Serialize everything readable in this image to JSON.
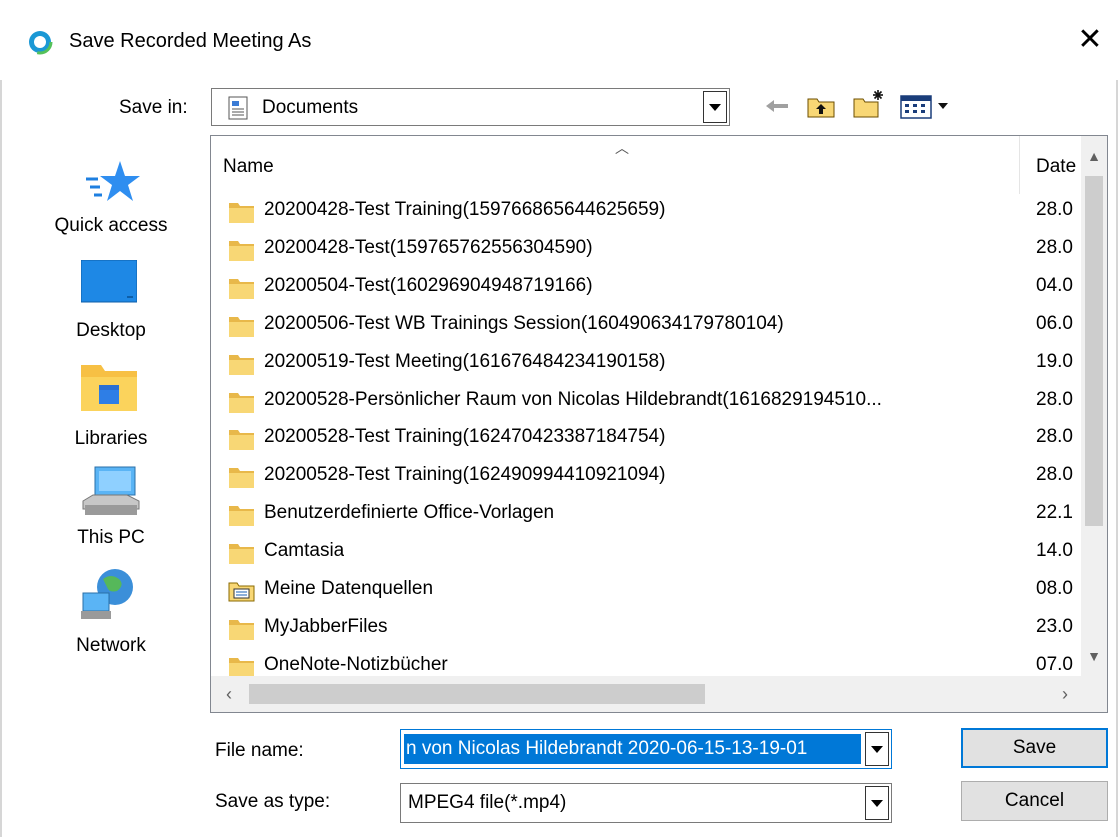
{
  "window": {
    "title": "Save Recorded Meeting As",
    "close": "✕"
  },
  "save_in": {
    "label": "Save in:",
    "value": "Documents"
  },
  "toolbar": {
    "back": "back-arrow",
    "up": "up-folder",
    "new_folder": "new-folder",
    "view_menu": "view-menu"
  },
  "places": [
    {
      "label": "Quick access",
      "icon": "quick-access-star-icon"
    },
    {
      "label": "Desktop",
      "icon": "desktop-icon"
    },
    {
      "label": "Libraries",
      "icon": "libraries-icon"
    },
    {
      "label": "This PC",
      "icon": "this-pc-icon"
    },
    {
      "label": "Network",
      "icon": "network-icon"
    }
  ],
  "list": {
    "columns": {
      "name": "Name",
      "date": "Date"
    },
    "rows": [
      {
        "name": "20200428-Test Training(159766865644625659)",
        "date": "28.0",
        "icon": "folder"
      },
      {
        "name": "20200428-Test(159765762556304590)",
        "date": "28.0",
        "icon": "folder"
      },
      {
        "name": "20200504-Test(160296904948719166)",
        "date": "04.0",
        "icon": "folder"
      },
      {
        "name": "20200506-Test WB Trainings Session(160490634179780104)",
        "date": "06.0",
        "icon": "folder"
      },
      {
        "name": "20200519-Test Meeting(161676484234190158)",
        "date": "19.0",
        "icon": "folder"
      },
      {
        "name": "20200528-Persönlicher Raum von Nicolas Hildebrandt(1616829194510...",
        "date": "28.0",
        "icon": "folder"
      },
      {
        "name": "20200528-Test Training(162470423387184754)",
        "date": "28.0",
        "icon": "folder"
      },
      {
        "name": "20200528-Test Training(162490994410921094)",
        "date": "28.0",
        "icon": "folder"
      },
      {
        "name": "Benutzerdefinierte Office-Vorlagen",
        "date": "22.1",
        "icon": "folder"
      },
      {
        "name": "Camtasia",
        "date": "14.0",
        "icon": "folder"
      },
      {
        "name": "Meine Datenquellen",
        "date": "08.0",
        "icon": "data-sources-folder"
      },
      {
        "name": "MyJabberFiles",
        "date": "23.0",
        "icon": "folder"
      },
      {
        "name": "OneNote-Notizbücher",
        "date": "07.0",
        "icon": "folder"
      }
    ]
  },
  "file_name": {
    "label": "File name:",
    "value": "n von Nicolas Hildebrandt 2020-06-15-13-19-01"
  },
  "save_type": {
    "label": "Save as type:",
    "value": "MPEG4 file(*.mp4)"
  },
  "buttons": {
    "save": "Save",
    "cancel": "Cancel"
  },
  "colors": {
    "selection": "#0078d7",
    "folder": "#f8d775",
    "folder_dark": "#e8b84a"
  }
}
